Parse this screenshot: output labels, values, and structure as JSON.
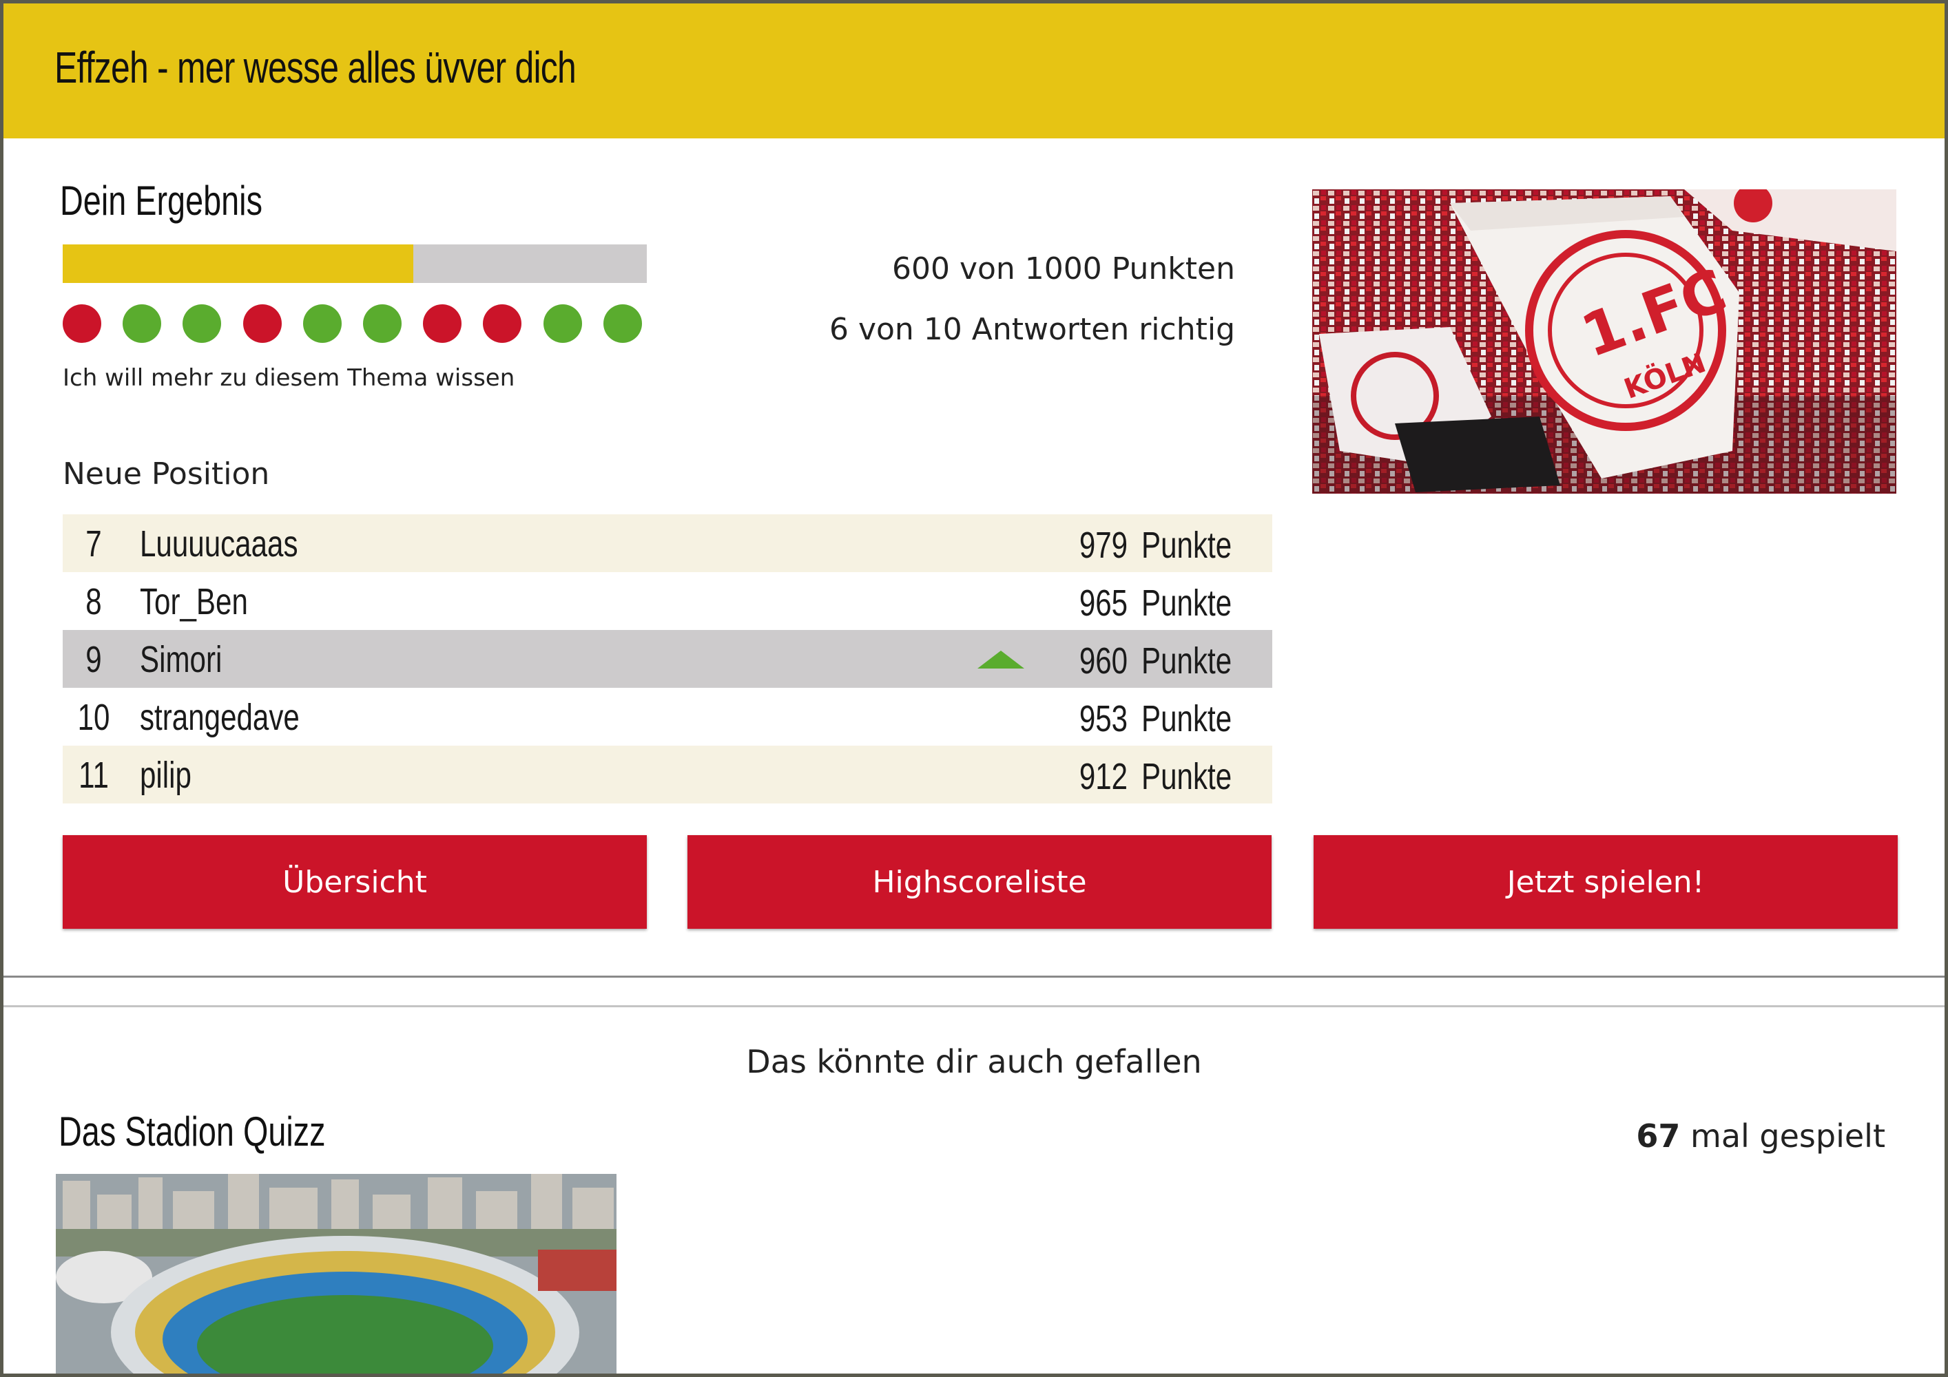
{
  "header": {
    "title": "Effzeh - mer wesse alles üvver dich"
  },
  "result": {
    "title": "Dein Ergebnis",
    "progress_fraction": 0.6,
    "answers": [
      "wrong",
      "correct",
      "correct",
      "wrong",
      "correct",
      "correct",
      "wrong",
      "wrong",
      "correct",
      "correct"
    ],
    "more_link": "Ich will mehr zu diesem Thema wissen",
    "points_text": "600 von 1000 Punkten",
    "correct_text": "6 von 10 Antworten richtig"
  },
  "ranking": {
    "heading": "Neue Position",
    "unit": "Punkte",
    "rows": [
      {
        "pos": "7",
        "name": "Luuuucaaas",
        "points": "979"
      },
      {
        "pos": "8",
        "name": "Tor_Ben",
        "points": "965"
      },
      {
        "pos": "9",
        "name": "Simori",
        "points": "960"
      },
      {
        "pos": "10",
        "name": "strangedave",
        "points": "953"
      },
      {
        "pos": "11",
        "name": "pilip",
        "points": "912"
      }
    ]
  },
  "buttons": {
    "overview": "Übersicht",
    "highscore": "Highscoreliste",
    "play": "Jetzt spielen!"
  },
  "suggestions": {
    "heading": "Das könnte dir auch gefallen",
    "quiz_title": "Das Stadion Quizz",
    "play_count": "67",
    "play_count_suffix": "mal gespielt"
  },
  "colors": {
    "brand_yellow": "#e6c414",
    "brand_red": "#cb1429",
    "correct_green": "#5aac2e",
    "neutral_grey": "#cdcbcc",
    "row_cream": "#f6f2e2"
  }
}
